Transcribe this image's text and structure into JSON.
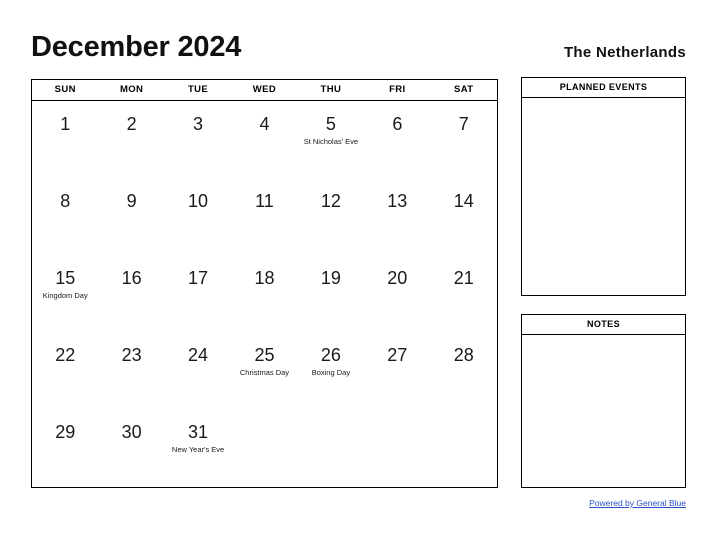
{
  "header": {
    "month_title": "December 2024",
    "country": "The Netherlands"
  },
  "calendar": {
    "weekdays": [
      "SUN",
      "MON",
      "TUE",
      "WED",
      "THU",
      "FRI",
      "SAT"
    ],
    "weeks": [
      [
        {
          "day": "1",
          "event": ""
        },
        {
          "day": "2",
          "event": ""
        },
        {
          "day": "3",
          "event": ""
        },
        {
          "day": "4",
          "event": ""
        },
        {
          "day": "5",
          "event": "St Nicholas' Eve"
        },
        {
          "day": "6",
          "event": ""
        },
        {
          "day": "7",
          "event": ""
        }
      ],
      [
        {
          "day": "8",
          "event": ""
        },
        {
          "day": "9",
          "event": ""
        },
        {
          "day": "10",
          "event": ""
        },
        {
          "day": "11",
          "event": ""
        },
        {
          "day": "12",
          "event": ""
        },
        {
          "day": "13",
          "event": ""
        },
        {
          "day": "14",
          "event": ""
        }
      ],
      [
        {
          "day": "15",
          "event": "Kingdom Day"
        },
        {
          "day": "16",
          "event": ""
        },
        {
          "day": "17",
          "event": ""
        },
        {
          "day": "18",
          "event": ""
        },
        {
          "day": "19",
          "event": ""
        },
        {
          "day": "20",
          "event": ""
        },
        {
          "day": "21",
          "event": ""
        }
      ],
      [
        {
          "day": "22",
          "event": ""
        },
        {
          "day": "23",
          "event": ""
        },
        {
          "day": "24",
          "event": ""
        },
        {
          "day": "25",
          "event": "Christmas Day"
        },
        {
          "day": "26",
          "event": "Boxing Day"
        },
        {
          "day": "27",
          "event": ""
        },
        {
          "day": "28",
          "event": ""
        }
      ],
      [
        {
          "day": "29",
          "event": ""
        },
        {
          "day": "30",
          "event": ""
        },
        {
          "day": "31",
          "event": "New Year's Eve"
        },
        {
          "day": "",
          "event": ""
        },
        {
          "day": "",
          "event": ""
        },
        {
          "day": "",
          "event": ""
        },
        {
          "day": "",
          "event": ""
        }
      ]
    ]
  },
  "panels": {
    "planned_events_title": "PLANNED EVENTS",
    "notes_title": "NOTES"
  },
  "footer": {
    "link_text": "Powered by General Blue"
  },
  "colors": {
    "link": "#2a4fc4",
    "border": "#000000",
    "text": "#111111"
  }
}
